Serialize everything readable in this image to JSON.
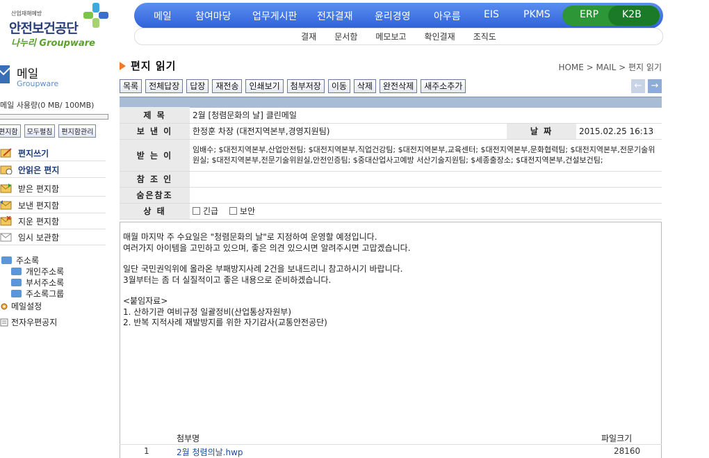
{
  "header": {
    "logo_slogan": "산업재해예방",
    "logo_name": "안전보건공단",
    "logo_sub": "나누리 Groupware",
    "topnav": [
      "메일",
      "참여마당",
      "업무게시판",
      "전자결재",
      "윤리경영",
      "아우름",
      "EIS",
      "PKMS",
      "ERP",
      "K2B"
    ],
    "subnav": [
      "결재",
      "문서함",
      "메모보고",
      "확인결재",
      "조직도"
    ]
  },
  "sidebar": {
    "title": "메일",
    "subtitle": "Groupware",
    "usage": "메일 사용량(0 MB/ 100MB)",
    "usage_fraction": 0,
    "buttons": [
      "편지함",
      "모두펼침",
      "편지함관리"
    ],
    "menu": [
      {
        "label": "편지쓰기",
        "bold": true
      },
      {
        "label": "안읽은 편지",
        "bold": true
      },
      {
        "label": "받은 편지함",
        "bold": false
      },
      {
        "label": "보낸 편지함",
        "bold": false
      },
      {
        "label": "지운 편지함",
        "bold": false
      },
      {
        "label": "임시 보관함",
        "bold": false
      }
    ],
    "addressbook": "주소록",
    "addressbook_items": [
      "개인주소록",
      "부서주소록",
      "주소록그룹"
    ],
    "mail_settings": "메일설정",
    "notice": "전자우편공지"
  },
  "main": {
    "title": "편지 읽기",
    "breadcrumb": "HOME > MAIL > 편지 읽기",
    "toolbar": [
      "목록",
      "전체답장",
      "답장",
      "재전송",
      "인쇄보기",
      "첨부저장",
      "이동",
      "삭제",
      "완전삭제",
      "새주소추가"
    ],
    "labels": {
      "subject": "제 목",
      "from": "보 낸 이",
      "date": "날 짜",
      "to": "받 는 이",
      "cc": "참 조 인",
      "bcc": "숨은참조",
      "status": "상 태"
    },
    "subject": "2월 [청렴문화의 날] 클린메일",
    "from": "한정훈 차장 (대전지역본부,경영지원팀)",
    "date": "2015.02.25 16:13",
    "to": "임배수; $대전지역본부,산업안전팀; $대전지역본부,직업건강팀; $대전지역본부,교육센터; $대전지역본부,문화협력팀; $대전지역본부,전문기술위원실; $대전지역본부,전문기술위원실,안전인증팀; $중대산업사고예방 서산기술지원팀; $세종출장소; $대전지역본부,건설보건팀;",
    "cc": "",
    "bcc": "",
    "status_urgent": "긴급",
    "status_secure": "보안",
    "body": [
      "매월 마지막 주 수요일은 \"청렴문화의 날\"로 지정하여 운영할 예정입니다.",
      "여러가지 아이템을 고민하고 있으며, 좋은 의견 있으시면 알려주시면 고맙겠습니다.",
      "",
      "일단 국민권익위에 올라온 부패방지사례 2건을 보내드리니 참고하시기 바랍니다.",
      "3월부터는 좀 더 실질적이고 좋은 내용으로 준비하겠습니다.",
      "",
      "<붙임자료>",
      "1. 산하기관 여비규정 일괄정비(산업통상자원부)",
      "2. 반복 지적사례 재발방지를 위한 자기감사(교통안전공단)"
    ],
    "attachments": {
      "col_name": "첨부명",
      "col_size": "파일크기",
      "rows": [
        {
          "no": "1",
          "name": "2월 청렴의날.hwp",
          "size": "28160"
        }
      ]
    }
  }
}
